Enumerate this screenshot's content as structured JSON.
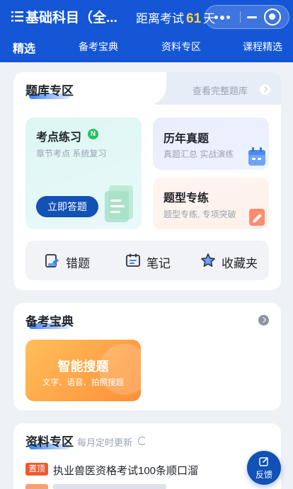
{
  "header": {
    "subject_title": "基础科目（全...",
    "countdown_prefix": "距离考试",
    "countdown_days": "61",
    "countdown_suffix": "天",
    "tabs": [
      {
        "label": "精选",
        "active": true
      },
      {
        "label": "备考宝典",
        "active": false
      },
      {
        "label": "资料专区",
        "active": false
      },
      {
        "label": "课程精选",
        "active": false
      }
    ]
  },
  "question_bank": {
    "title": "题库专区",
    "view_all": "查看完整题库",
    "kaodian": {
      "title": "考点练习",
      "badge": "N",
      "subtitle": "章节考点 系统复习",
      "button": "立即答题"
    },
    "linian": {
      "title": "历年真题",
      "subtitle": "真题汇总 实战演练"
    },
    "tixing": {
      "title": "题型专练",
      "subtitle": "题型专练, 专项突破"
    },
    "bottom_items": [
      {
        "label": "错题",
        "icon": "wrong-questions-icon"
      },
      {
        "label": "笔记",
        "icon": "notes-icon"
      },
      {
        "label": "收藏夹",
        "icon": "star-icon"
      }
    ]
  },
  "prep_guide": {
    "title": "备考宝典",
    "smart_search": {
      "title": "智能搜题",
      "subtitle": "文字、语音、拍照搜题"
    }
  },
  "materials": {
    "title": "资料专区",
    "update_note": "每月定时更新",
    "items": [
      {
        "badge": "置顶",
        "title": "执业兽医资格考试100条顺口溜"
      }
    ]
  },
  "feedback": {
    "label": "反馈"
  },
  "colors": {
    "primary": "#1456d6",
    "button": "#1251b5",
    "accent_yellow": "#ffd43b",
    "orange": "#ff8f3a",
    "pin_red": "#f05a2f"
  }
}
